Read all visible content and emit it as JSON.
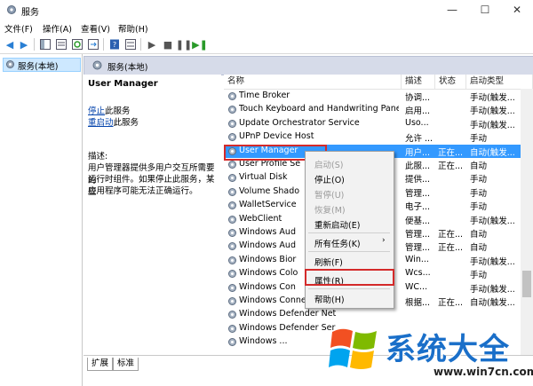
{
  "window": {
    "title": "服务",
    "min": "—",
    "max": "☐",
    "close": "✕"
  },
  "menu": [
    "文件(F)",
    "操作(A)",
    "查看(V)",
    "帮助(H)"
  ],
  "tree": {
    "root": "服务(本地)"
  },
  "pane": {
    "title": "服务(本地)"
  },
  "detail": {
    "name": "User Manager",
    "stop_link": "停止",
    "stop_rest": "此服务",
    "restart_link": "重启动",
    "restart_rest": "此服务",
    "desc_label": "描述:",
    "desc_lines": [
      "用户管理器提供多用户交互所需要的",
      "运行时组件。如果停止此服务，某些",
      "应用程序可能无法正确运行。"
    ]
  },
  "columns": [
    "名称",
    "描述",
    "状态",
    "启动类型"
  ],
  "rows": [
    {
      "name": "Time Broker",
      "desc": "协调...",
      "status": "",
      "start": "手动(触发..."
    },
    {
      "name": "Touch Keyboard and Handwriting Panel ...",
      "desc": "启用...",
      "status": "",
      "start": "手动(触发..."
    },
    {
      "name": "Update Orchestrator Service",
      "desc": "Uso...",
      "status": "",
      "start": "手动(触发..."
    },
    {
      "name": "UPnP Device Host",
      "desc": "允许 ...",
      "status": "",
      "start": "手动"
    },
    {
      "name": "User Manager",
      "desc": "用户...",
      "status": "正在...",
      "start": "自动(触发..."
    },
    {
      "name": "User Profile Se",
      "desc": "此服...",
      "status": "正在...",
      "start": "自动"
    },
    {
      "name": "Virtual Disk",
      "desc": "提供...",
      "status": "",
      "start": "手动"
    },
    {
      "name": "Volume Shado",
      "desc": "管理...",
      "status": "",
      "start": "手动"
    },
    {
      "name": "WalletService",
      "desc": "电子...",
      "status": "",
      "start": "手动"
    },
    {
      "name": "WebClient",
      "desc": "便基...",
      "status": "",
      "start": "手动(触发..."
    },
    {
      "name": "Windows Aud",
      "desc": "管理...",
      "status": "正在...",
      "start": "自动"
    },
    {
      "name": "Windows Aud",
      "desc": "管理...",
      "status": "正在...",
      "start": "自动"
    },
    {
      "name": "Windows Bior",
      "desc": "Win...",
      "status": "",
      "start": "手动(触发..."
    },
    {
      "name": "Windows Colo",
      "desc": "Wcs...",
      "status": "",
      "start": "手动"
    },
    {
      "name": "Windows Con",
      "desc": "WC...",
      "status": "",
      "start": "手动(触发..."
    },
    {
      "name": "Windows Connection Manager",
      "desc": "根据...",
      "status": "正在...",
      "start": "自动(触发..."
    },
    {
      "name": "Windows Defender Net",
      "desc": "",
      "status": "",
      "start": ""
    },
    {
      "name": "Windows Defender Ser",
      "desc": "",
      "status": "",
      "start": ""
    },
    {
      "name": "Windows ...",
      "desc": "",
      "status": "",
      "start": ""
    }
  ],
  "context_menu": {
    "start": "启动(S)",
    "stop": "停止(O)",
    "pause": "暂停(U)",
    "resume": "恢复(M)",
    "restart": "重新启动(E)",
    "all_tasks": "所有任务(K)",
    "refresh": "刷新(F)",
    "properties": "属性(R)",
    "help": "帮助(H)"
  },
  "tabs": [
    "扩展",
    "标准"
  ],
  "watermark": {
    "text": "系统大全",
    "url": "www.win7cn.com"
  },
  "colors": {
    "selection": "#3399ff",
    "highlight_box": "#d42a2a",
    "header": "#d6dbe9",
    "link": "#0645ad"
  }
}
